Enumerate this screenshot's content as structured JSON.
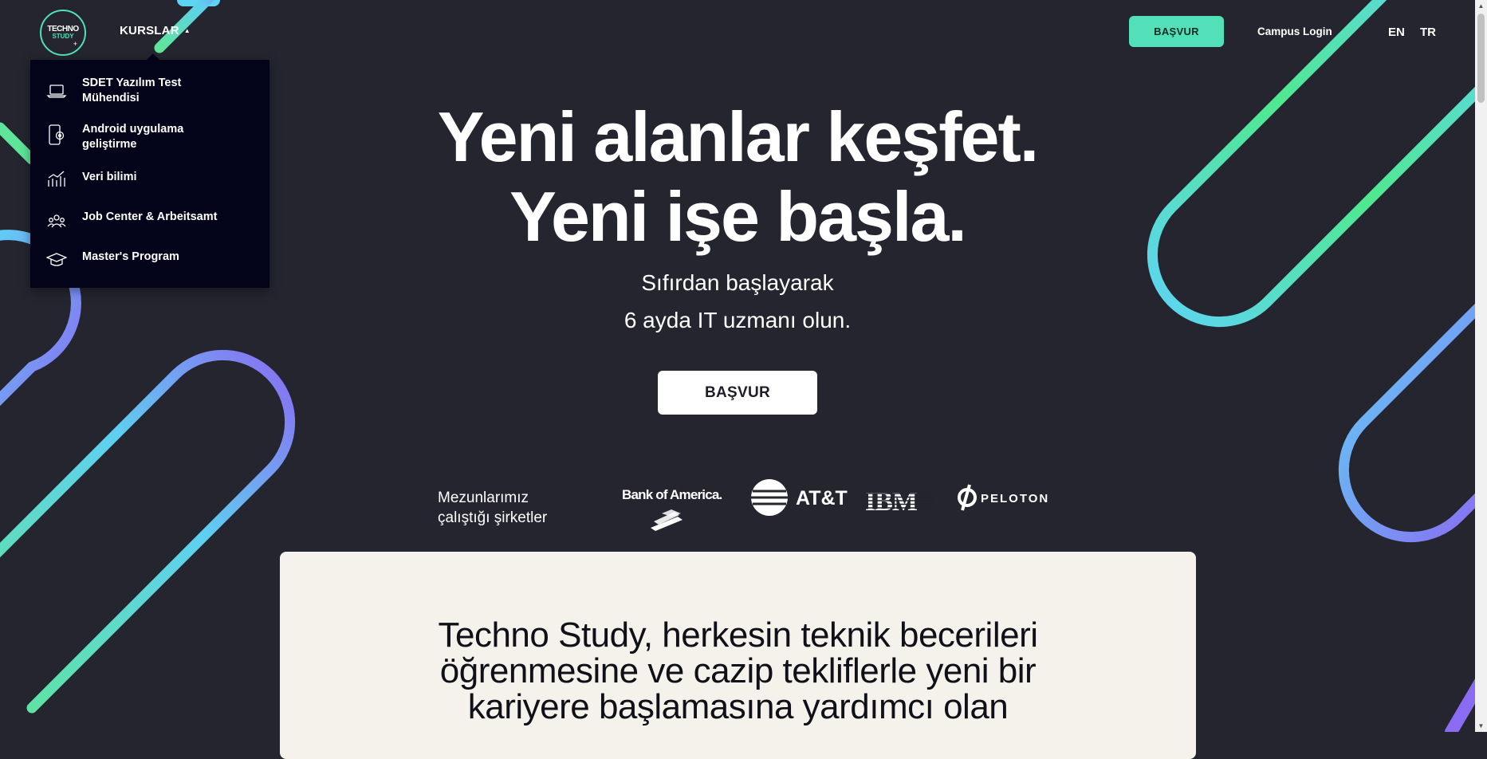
{
  "logo": {
    "line1": "TECHNO",
    "line2": "STUDY",
    "plus": "+"
  },
  "nav": {
    "courses_label": "KURSLAR",
    "caret": "▲"
  },
  "dropdown": {
    "items": [
      {
        "label": "SDET Yazılım Test Mühendisi",
        "icon": "laptop-icon",
        "active": false
      },
      {
        "label": "Android uygulama geliştirme",
        "icon": "mobile-gear-icon",
        "active": false
      },
      {
        "label": "Veri bilimi",
        "icon": "bar-chart-icon",
        "active": true
      },
      {
        "label": "Job Center & Arbeitsamt",
        "icon": "people-icon",
        "active": false
      },
      {
        "label": "Master's Program",
        "icon": "graduation-cap-icon",
        "active": false
      }
    ]
  },
  "header": {
    "apply_label": "BAŞVUR",
    "campus_login": "Campus Login",
    "lang_en": "EN",
    "lang_tr": "TR"
  },
  "hero": {
    "title_line1": "Yeni alanlar keşfet.",
    "title_line2": "Yeni işe başla.",
    "subtitle_line1": "Sıfırdan başlayarak",
    "subtitle_line2": "6 ayda IT uzmanı olun.",
    "apply_label": "BAŞVUR"
  },
  "graduates": {
    "label_line1": "Mezunlarımız",
    "label_line2": "çalıştığı şirketler",
    "companies": [
      "Bank of America.",
      "AT&T",
      "IBM",
      "PELOTON"
    ]
  },
  "info": {
    "text": "Techno Study, herkesin teknik becerileri öğrenmesine ve cazip tekliflerle yeni bir kariyere başlamasına yardımcı olan"
  },
  "colors": {
    "background": "#24252f",
    "accent": "#52e0b8",
    "dropdown_bg": "#03041a",
    "card_bg": "#f5f2ec"
  }
}
